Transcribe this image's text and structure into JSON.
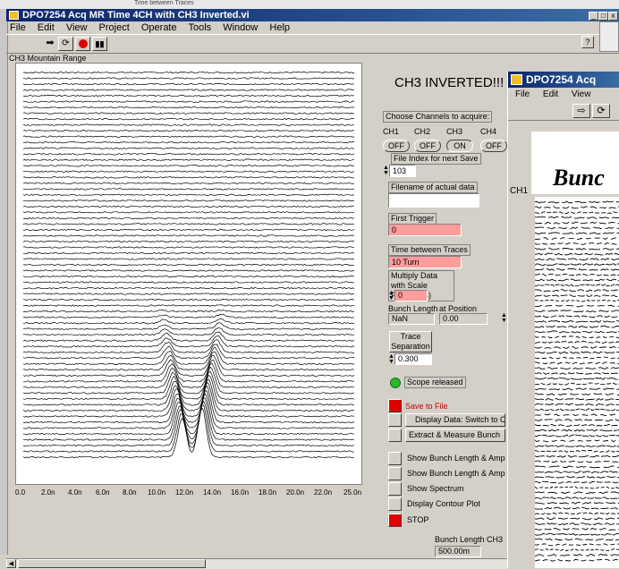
{
  "window": {
    "title": "DPO7254 Acq MR Time 4CH with CH3 Inverted.vi"
  },
  "menu": [
    "File",
    "Edit",
    "View",
    "Project",
    "Operate",
    "Tools",
    "Window",
    "Help"
  ],
  "bg_window_text": "Time between Traces",
  "plot": {
    "label": "CH3 Mountain Range",
    "x_ticks": [
      "0.0",
      "2.0n",
      "4.0n",
      "6.0n",
      "8.0n",
      "10.0n",
      "12.0n",
      "14.0n",
      "16.0n",
      "18.0n",
      "20.0n",
      "22.0n",
      "25.0n"
    ]
  },
  "panel": {
    "heading": "CH3 INVERTED!!!",
    "choose_label": "Choose Channels to acquire:",
    "channels": [
      {
        "name": "CH1",
        "state": "OFF"
      },
      {
        "name": "CH2",
        "state": "OFF"
      },
      {
        "name": "CH3",
        "state": "ON"
      },
      {
        "name": "CH4",
        "state": "OFF"
      }
    ],
    "file_index_label": "File Index for next Save",
    "file_index_value": "103",
    "filename_label": "Filename of actual data",
    "filename_value": "",
    "first_trigger_label": "First Trigger",
    "first_trigger_value": "0",
    "time_between_label": "Time between Traces",
    "time_between_value": "10 Turn",
    "multiply_label": "Multiply Data with Scale Factor (dB)",
    "multiply_value": "0",
    "bunch_length_label": "Bunch Length",
    "at_position_label": "at Position",
    "bunch_length_value": "NaN",
    "at_position_value": "0.00",
    "trace_sep_label": "Trace Separation",
    "trace_sep_value": "0.300",
    "scope_status": "Scope released",
    "buttons": [
      {
        "label": "Save to File",
        "active": true
      },
      {
        "label": "Display Data: Switch to C",
        "active": false
      },
      {
        "label": "Extract & Measure Bunch",
        "active": false
      },
      {
        "label": "Show Bunch Length & Amplitu",
        "active": false
      },
      {
        "label": "Show Bunch Length & Amplitu",
        "active": false
      },
      {
        "label": "Show Spectrum",
        "active": false
      },
      {
        "label": "Display Contour Plot",
        "active": false
      },
      {
        "label": "STOP",
        "active": true
      }
    ],
    "bunch_length_ch3_label": "Bunch Length CH3",
    "bunch_length_ch3_value": "500.00m"
  },
  "window2": {
    "title": "DPO7254 Acq",
    "menu": [
      "File",
      "Edit",
      "View"
    ],
    "plot_label": "CH1",
    "banner": "Bunc"
  },
  "chart_data": {
    "type": "line",
    "title": "CH3 Mountain Range",
    "xlabel": "",
    "ylabel": "",
    "x_range": [
      0,
      25
    ],
    "x_unit": "ns",
    "traces": 67,
    "peak_positions_ns": [
      12,
      13.5
    ]
  },
  "colors": {
    "pink_field": "#ff9c9c",
    "red_button": "#e00000",
    "led_green": "#2db52d",
    "title_blue": "#0a246a"
  }
}
